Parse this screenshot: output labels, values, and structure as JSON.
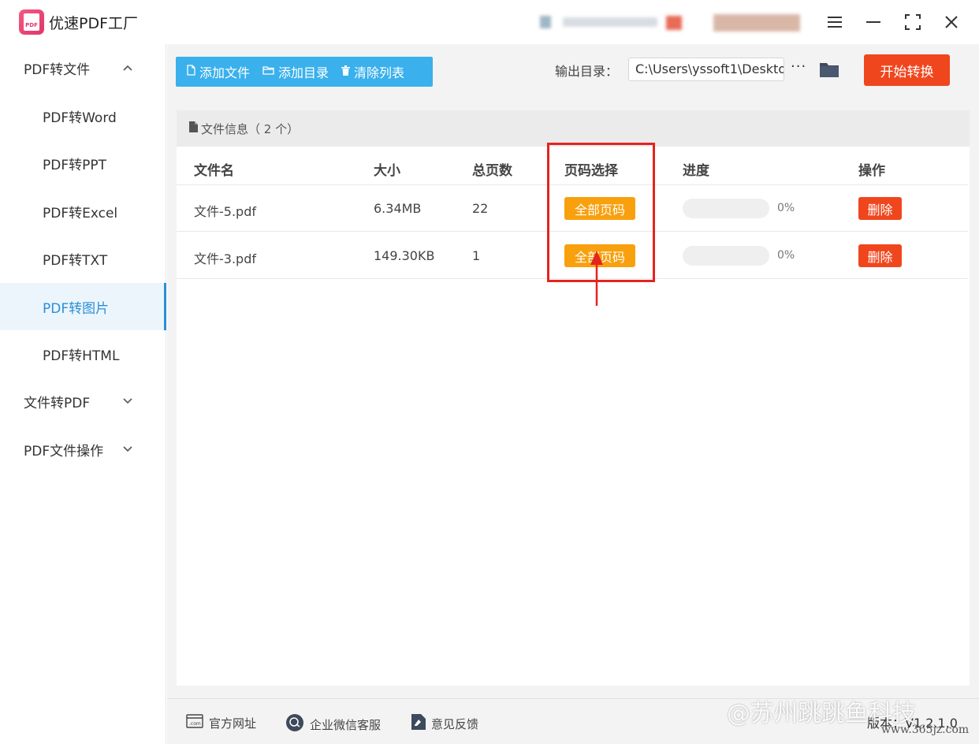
{
  "app": {
    "title": "优速PDF工厂",
    "logo_text": "PDF"
  },
  "sidebar": {
    "groups": [
      {
        "label": "PDF转文件",
        "expanded": true
      },
      {
        "label": "文件转PDF",
        "expanded": false
      },
      {
        "label": "PDF文件操作",
        "expanded": false
      }
    ],
    "items": [
      {
        "label": "PDF转Word"
      },
      {
        "label": "PDF转PPT"
      },
      {
        "label": "PDF转Excel"
      },
      {
        "label": "PDF转TXT"
      },
      {
        "label": "PDF转图片",
        "active": true
      },
      {
        "label": "PDF转HTML"
      }
    ]
  },
  "toolbar": {
    "add_file": "添加文件",
    "add_folder": "添加目录",
    "clear_list": "清除列表",
    "output_label": "输出目录：",
    "output_path": "C:\\Users\\yssoft1\\Deskto",
    "more": "···",
    "start": "开始转换"
  },
  "file_panel": {
    "header": "文件信息（ 2 个）",
    "columns": [
      "文件名",
      "大小",
      "总页数",
      "页码选择",
      "进度",
      "操作"
    ],
    "rows": [
      {
        "name": "文件-5.pdf",
        "size": "6.34MB",
        "pages": "22",
        "page_select": "全部页码",
        "progress": "0%",
        "progress_value": 0,
        "action": "删除"
      },
      {
        "name": "文件-3.pdf",
        "size": "149.30KB",
        "pages": "1",
        "page_select": "全部页码",
        "progress": "0%",
        "progress_value": 0,
        "action": "删除"
      }
    ]
  },
  "footer": {
    "website": "官方网址",
    "wechat": "企业微信客服",
    "feedback": "意见反馈",
    "version": "版本：V1.2.1.0"
  },
  "overlay": {
    "watermark": "@苏州跳跳鱼科技",
    "site": "www.365jz.com"
  },
  "colors": {
    "accent_blue": "#3ab0ec",
    "start_red": "#f0461e",
    "page_orange": "#f8a00d",
    "highlight_red": "#e5231f"
  }
}
